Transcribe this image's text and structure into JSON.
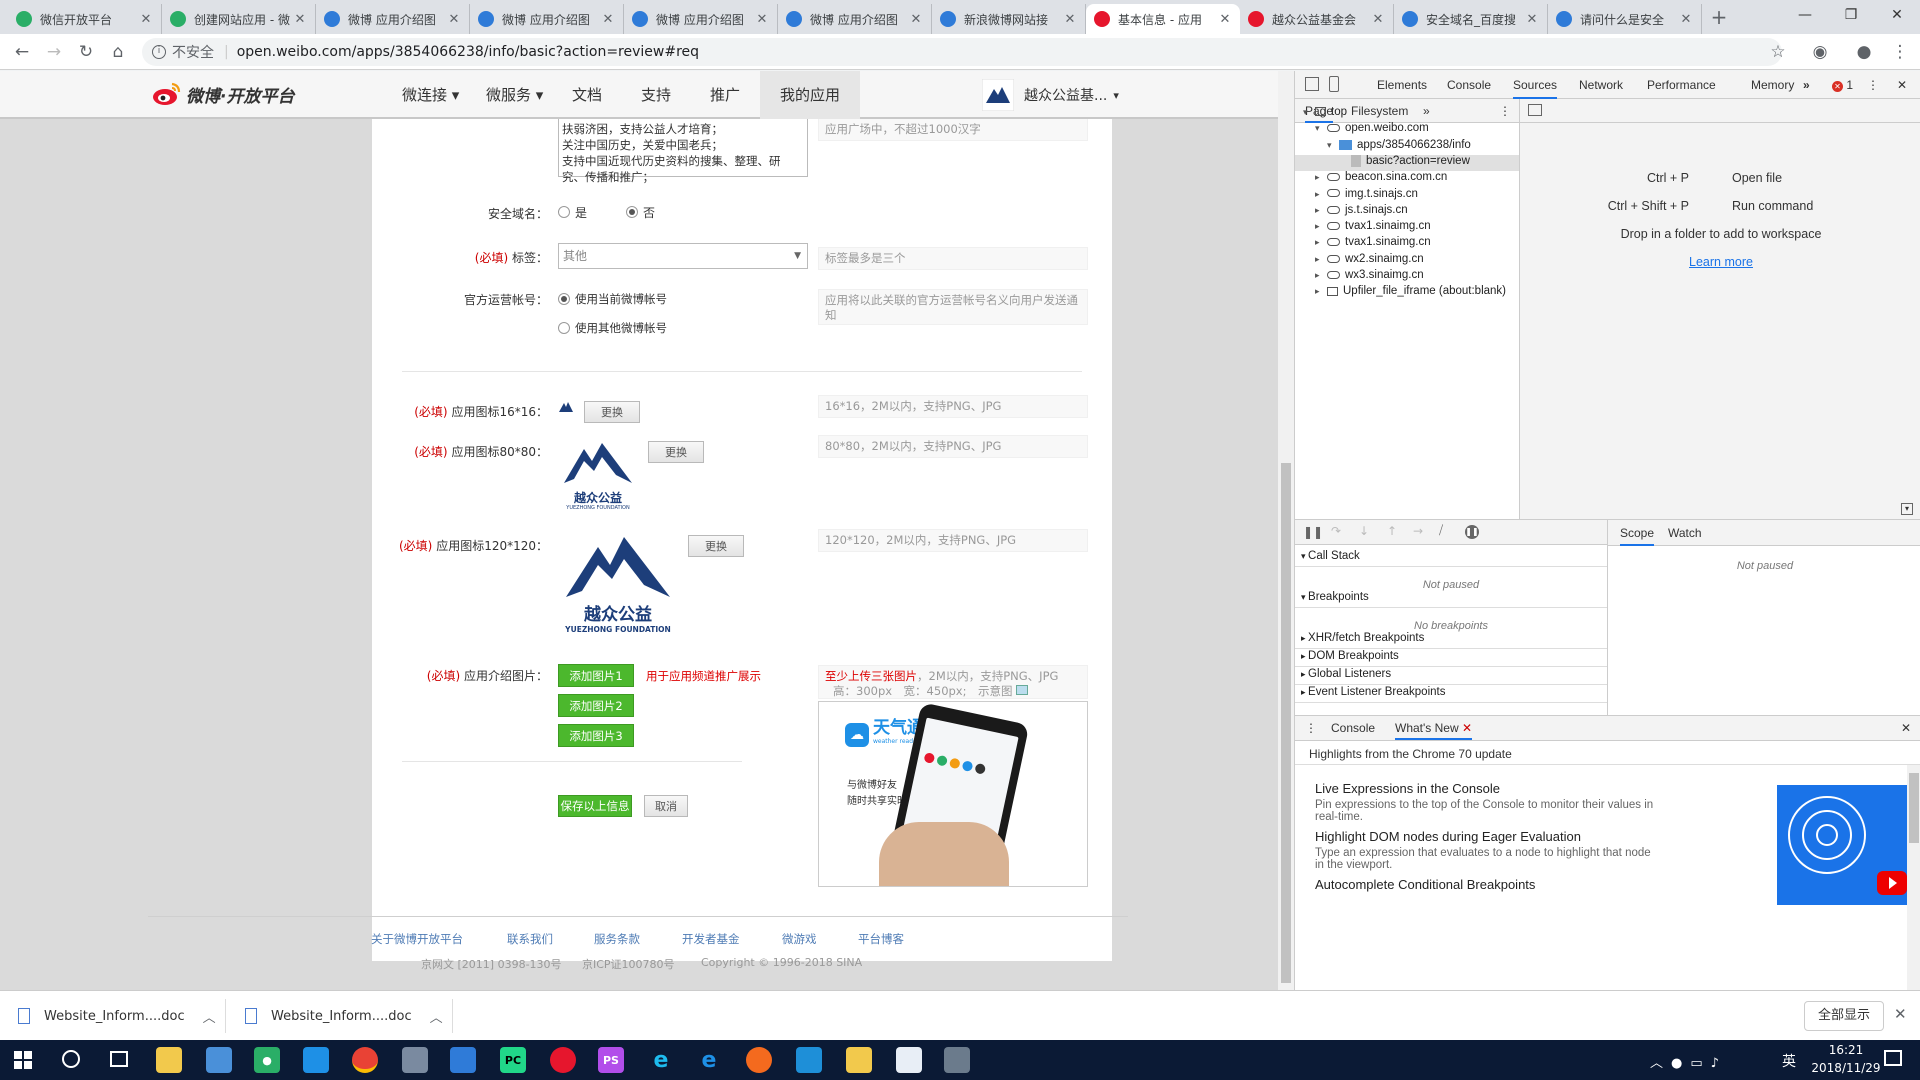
{
  "tabs": [
    {
      "title": "微信开放平台",
      "color": "#2aae67",
      "icon": "wechat-icon"
    },
    {
      "title": "创建网站应用 - 微",
      "color": "#2aae67",
      "icon": "wechat-icon"
    },
    {
      "title": "微博 应用介绍图",
      "color": "#2f7bd8",
      "icon": "paw-icon"
    },
    {
      "title": "微博 应用介绍图",
      "color": "#2f7bd8",
      "icon": "paw-icon"
    },
    {
      "title": "微博 应用介绍图",
      "color": "#2f7bd8",
      "icon": "paw-icon"
    },
    {
      "title": "微博 应用介绍图",
      "color": "#2f7bd8",
      "icon": "paw-icon"
    },
    {
      "title": "新浪微博网站接",
      "color": "#2f7bd8",
      "icon": "paw-icon"
    },
    {
      "title": "基本信息 - 应用",
      "color": "#e6162d",
      "icon": "weibo-icon",
      "active": true
    },
    {
      "title": "越众公益基金会",
      "color": "#e6162d",
      "icon": "weibo-icon"
    },
    {
      "title": "安全域名_百度搜",
      "color": "#2f7bd8",
      "icon": "paw-icon"
    },
    {
      "title": "请问什么是安全",
      "color": "#2f7bd8",
      "icon": "paw-icon"
    }
  ],
  "address": {
    "security": "不安全",
    "url": "open.weibo.com/apps/3854066238/info/basic?action=review#req"
  },
  "site": {
    "logo": "微博·开放平台",
    "nav": [
      "微连接",
      "微服务",
      "文档",
      "支持",
      "推广",
      "我的应用"
    ],
    "account": "越众公益基..."
  },
  "form": {
    "description_lines": [
      "扶弱济困，支持公益人才培育；",
      "关注中国历史，关爱中国老兵；",
      "支持中国近现代历史资料的搜集、整理、研",
      "究、传播和推广；"
    ],
    "description_hint": "应用广场中，不超过1000汉字",
    "secure_domain_label": "安全域名：",
    "secure_yes": "是",
    "secure_no": "否",
    "required": "(必填)",
    "tag_label": "标签：",
    "tag_value": "其他",
    "tag_hint": "标签最多是三个",
    "official_label": "官方运营帐号：",
    "official_opt1": "使用当前微博帐号",
    "official_opt2": "使用其他微博帐号",
    "official_hint": "应用将以此关联的官方运营帐号名义向用户发送通知",
    "icon16_label": "应用图标16*16：",
    "icon80_label": "应用图标80*80：",
    "icon120_label": "应用图标120*120：",
    "replace": "更换",
    "icon16_hint": "16*16，2M以内，支持PNG、JPG",
    "icon80_hint": "80*80，2M以内，支持PNG、JPG",
    "icon120_hint": "120*120，2M以内，支持PNG、JPG",
    "logo_cn": "越众公益",
    "logo_en": "YUEZHONG FOUNDATION",
    "intro_label": "应用介绍图片：",
    "add1": "添加图片1",
    "add2": "添加图片2",
    "add3": "添加图片3",
    "intro_note": "用于应用频道推广展示",
    "intro_hint_red": "至少上传三张图片",
    "intro_hint_rest": "，2M以内，支持PNG、JPG",
    "intro_hint_line2": "高：300px　宽：450px;　示意图",
    "preview_brand": "天气通",
    "preview_brand_en": "weather reader",
    "preview_text1": "与微博好友",
    "preview_text2": "随时共享实时天气",
    "save": "保存以上信息",
    "cancel": "取消"
  },
  "footer": {
    "links": [
      "关于微博开放平台",
      "联系我们",
      "服务条款",
      "开发者基金",
      "微游戏",
      "平台博客"
    ],
    "icp1": "京网文 [2011] 0398-130号",
    "icp2": "京ICP证100780号",
    "copyright": "Copyright © 1996-2018 SINA"
  },
  "devtools": {
    "tabs": [
      "Elements",
      "Console",
      "Sources",
      "Network",
      "Performance",
      "Memory"
    ],
    "active_tab": "Sources",
    "error_count": "1",
    "subtabs": [
      "Page",
      "Filesystem"
    ],
    "tree": [
      {
        "label": "top",
        "level": 0,
        "type": "frame"
      },
      {
        "label": "open.weibo.com",
        "level": 1,
        "type": "cloud"
      },
      {
        "label": "apps/3854066238/info",
        "level": 2,
        "type": "folder"
      },
      {
        "label": "basic?action=review",
        "level": 3,
        "type": "file",
        "selected": true
      },
      {
        "label": "beacon.sina.com.cn",
        "level": 1,
        "type": "cloud"
      },
      {
        "label": "img.t.sinajs.cn",
        "level": 1,
        "type": "cloud"
      },
      {
        "label": "js.t.sinajs.cn",
        "level": 1,
        "type": "cloud"
      },
      {
        "label": "tvax1.sinaimg.cn",
        "level": 1,
        "type": "cloud"
      },
      {
        "label": "tvax1.sinaimg.cn",
        "level": 1,
        "type": "cloud"
      },
      {
        "label": "wx2.sinaimg.cn",
        "level": 1,
        "type": "cloud"
      },
      {
        "label": "wx3.sinaimg.cn",
        "level": 1,
        "type": "cloud"
      },
      {
        "label": "Upfiler_file_iframe (about:blank)",
        "level": 1,
        "type": "frame"
      }
    ],
    "shortcuts": [
      {
        "keys": "Ctrl + P",
        "action": "Open file"
      },
      {
        "keys": "Ctrl + Shift + P",
        "action": "Run command"
      }
    ],
    "drop_text": "Drop in a folder to add to workspace",
    "learn_more": "Learn more",
    "sections": [
      "Call Stack",
      "Breakpoints",
      "XHR/fetch Breakpoints",
      "DOM Breakpoints",
      "Global Listeners",
      "Event Listener Breakpoints"
    ],
    "not_paused": "Not paused",
    "no_breakpoints": "No breakpoints",
    "scope_tabs": [
      "Scope",
      "Watch"
    ],
    "drawer_tabs": [
      "Console",
      "What's New"
    ],
    "highlights": "Highlights from the Chrome 70 update",
    "news": [
      {
        "title": "Live Expressions in the Console",
        "body": "Pin expressions to the top of the Console to monitor their values in real-time."
      },
      {
        "title": "Highlight DOM nodes during Eager Evaluation",
        "body": "Type an expression that evaluates to a node to highlight that node in the viewport."
      },
      {
        "title": "Autocomplete Conditional Breakpoints",
        "body": ""
      }
    ]
  },
  "downloads": {
    "items": [
      "Website_Inform....doc",
      "Website_Inform....doc"
    ],
    "show_all": "全部显示"
  },
  "taskbar": {
    "time": "16:21",
    "date": "2018/11/29",
    "ime": "英"
  }
}
